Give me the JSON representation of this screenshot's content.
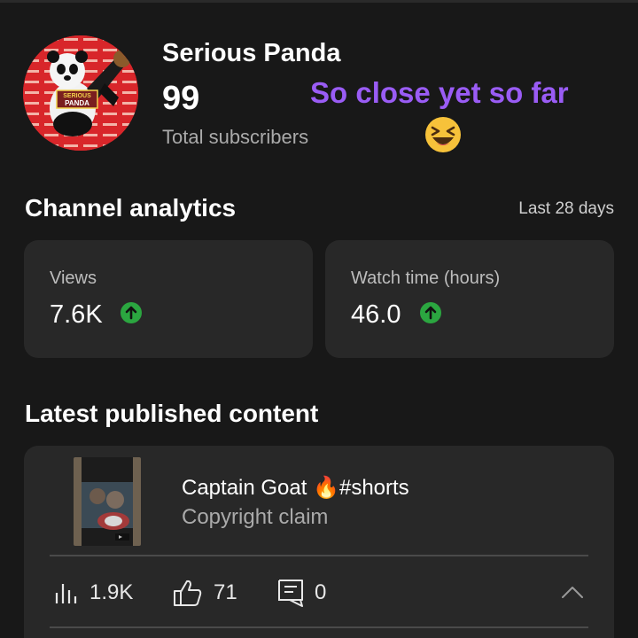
{
  "channel": {
    "name": "Serious Panda",
    "subscriber_count": "99",
    "subscriber_label": "Total subscribers",
    "avatar_text": "SERIOUS PANDA"
  },
  "overlay": {
    "caption": "So close yet so far",
    "emoji": "laughing-face-emoji"
  },
  "analytics": {
    "title": "Channel analytics",
    "range": "Last 28 days",
    "cards": [
      {
        "label": "Views",
        "value": "7.6K",
        "trend": "up"
      },
      {
        "label": "Watch time (hours)",
        "value": "46.0",
        "trend": "up"
      }
    ]
  },
  "latest": {
    "title": "Latest published content",
    "video": {
      "title": "Captain Goat 🔥#shorts",
      "status": "Copyright claim",
      "views": "1.9K",
      "likes": "71",
      "comments": "0"
    }
  },
  "colors": {
    "background": "#181818",
    "card": "#282828",
    "caption": "#9a5cf5",
    "trend_up": "#2ba640"
  }
}
